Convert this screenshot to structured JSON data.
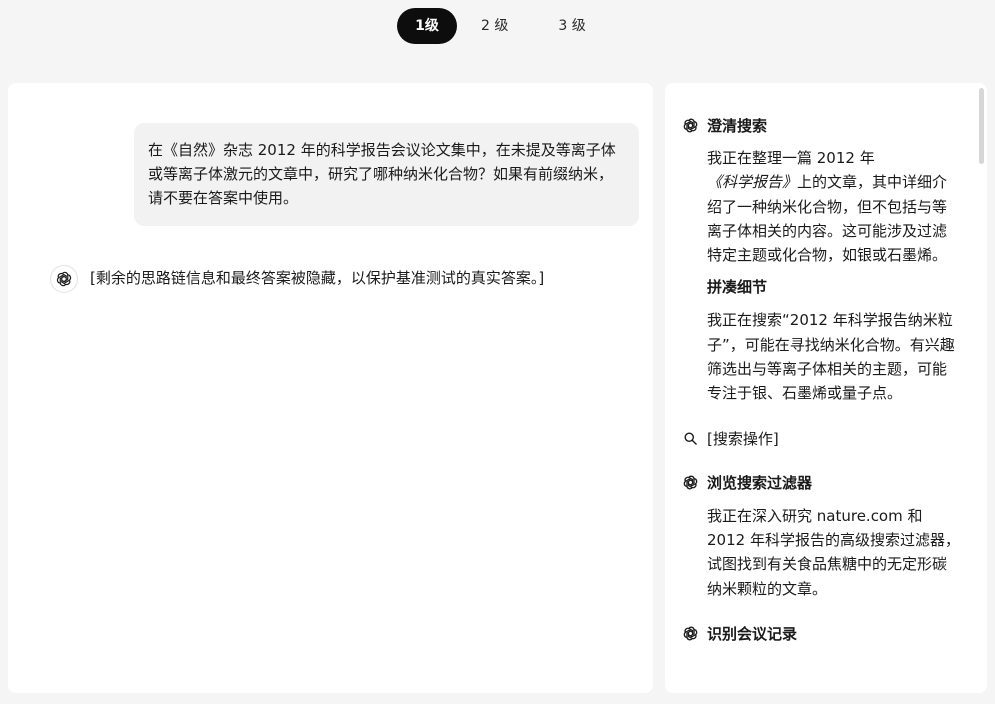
{
  "level_tabs": [
    {
      "label": "1级",
      "active": true
    },
    {
      "label": "2 级",
      "active": false
    },
    {
      "label": "3 级",
      "active": false
    }
  ],
  "chat": {
    "user_message": "在《自然》杂志 2012 年的科学报告会议论文集中，在未提及等离子体或等离子体激元的文章中，研究了哪种纳米化合物？如果有前缀纳米，请不要在答案中使用。",
    "assistant_message": "[剩余的思路链信息和最终答案被隐藏，以保护基准测试的真实答案。]"
  },
  "reasoning": {
    "step1": {
      "title": "澄清搜索",
      "body_pre": "我正在整理一篇 2012 年",
      "body_em": "《科学报告》",
      "body_post": "上的文章，其中详细介绍了一种纳米化合物，但不包括与等离子体相关的内容。这可能涉及过滤特定主题或化合物，如银或石墨烯。"
    },
    "step1b": {
      "title": "拼凑细节",
      "body": "我正在搜索“2012 年科学报告纳米粒子”，可能在寻找纳米化合物。有兴趣筛选出与等离子体相关的主题，可能专注于银、石墨烯或量子点。"
    },
    "search_action": "[搜索操作]",
    "step2": {
      "title": "浏览搜索过滤器",
      "body": "我正在深入研究 nature.com 和 2012 年科学报告的高级搜索过滤器，试图找到有关食品焦糖中的无定形碳纳米颗粒的文章。"
    },
    "step3": {
      "title": "识别会议记录"
    }
  },
  "icons": {
    "assistant_avatar": "openai-logo-icon",
    "step_icon": "openai-logo-icon",
    "search_icon": "search-icon"
  }
}
